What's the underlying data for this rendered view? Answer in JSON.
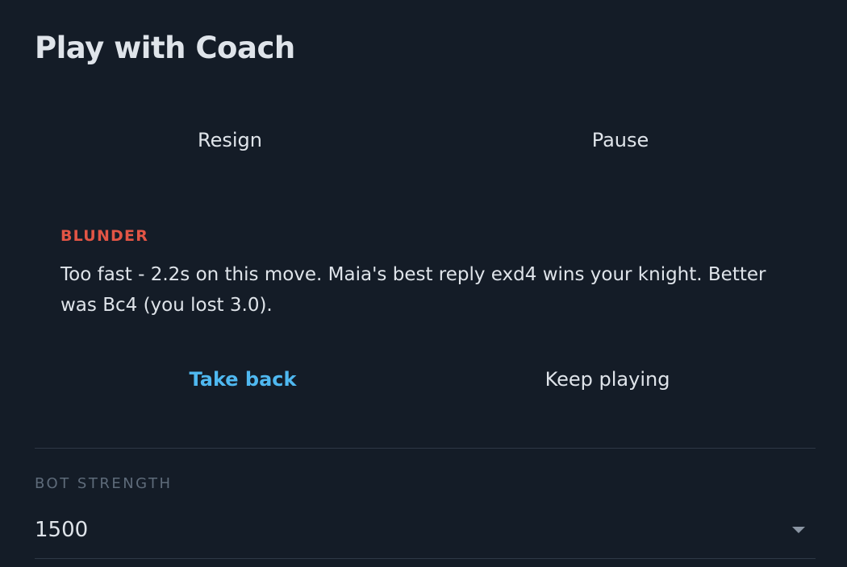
{
  "header": {
    "title": "Play with Coach"
  },
  "game_controls": {
    "resign_label": "Resign",
    "pause_label": "Pause"
  },
  "feedback": {
    "verdict": "BLUNDER",
    "verdict_color": "#e25545",
    "message": "Too fast - 2.2s on this move. Maia's best reply exd4 wins your knight. Better was Bc4 (you lost 3.0).",
    "take_back_label": "Take back",
    "keep_playing_label": "Keep playing",
    "accent_color": "#4fb8f0"
  },
  "settings": {
    "bot_strength_label": "BOT STRENGTH",
    "bot_strength_value": "1500",
    "dropdown_icon": "caret-down-icon"
  },
  "theme": {
    "background": "#141c27",
    "text": "#dfe4ea",
    "muted_text": "#5e6b7a",
    "divider": "#2e3846"
  }
}
